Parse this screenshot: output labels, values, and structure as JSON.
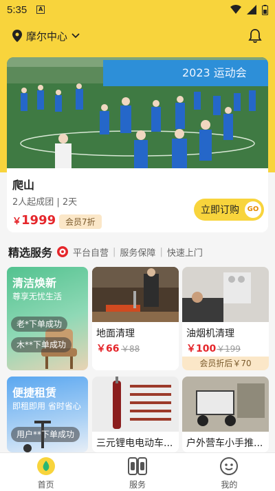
{
  "status_bar": {
    "time": "5:35",
    "badge": "A"
  },
  "header": {
    "location": "摩尔中心"
  },
  "featured": {
    "title": "爬山",
    "meta": "2人起成团 | 2天",
    "price_symbol": "￥",
    "price": "1999",
    "vip_badge": "会员7折",
    "buy_label": "立即订购",
    "go_label": "GO",
    "banner_text": "2023 运动会"
  },
  "section": {
    "title": "精选服务",
    "tags": [
      "平台自营",
      "服务保障",
      "快速上门"
    ]
  },
  "promo_cards": [
    {
      "title": "清洁焕新",
      "subtitle": "尊享无忧生活",
      "pills": [
        "老*下单成功",
        "木**下单成功"
      ]
    },
    {
      "title": "便捷租赁",
      "subtitle": "即租即用 省时省心",
      "pills": [
        "用户**下单成功"
      ]
    }
  ],
  "service_tiles": [
    {
      "name": "地面清理",
      "price": "￥66",
      "old_price": "￥88"
    },
    {
      "name": "油烟机清理",
      "price": "￥100",
      "old_price": "￥199",
      "vip": "会员折后￥70"
    },
    {
      "name": "三元锂电电动车..."
    },
    {
      "name": "户外营车小手推..."
    }
  ],
  "tabbar": {
    "tabs": [
      "首页",
      "服务",
      "我的"
    ]
  },
  "colors": {
    "brand_yellow": "#f8d43c",
    "price_red": "#e5262b",
    "vip_bg": "#fbe7c8",
    "nav_green": "#2bb673"
  }
}
